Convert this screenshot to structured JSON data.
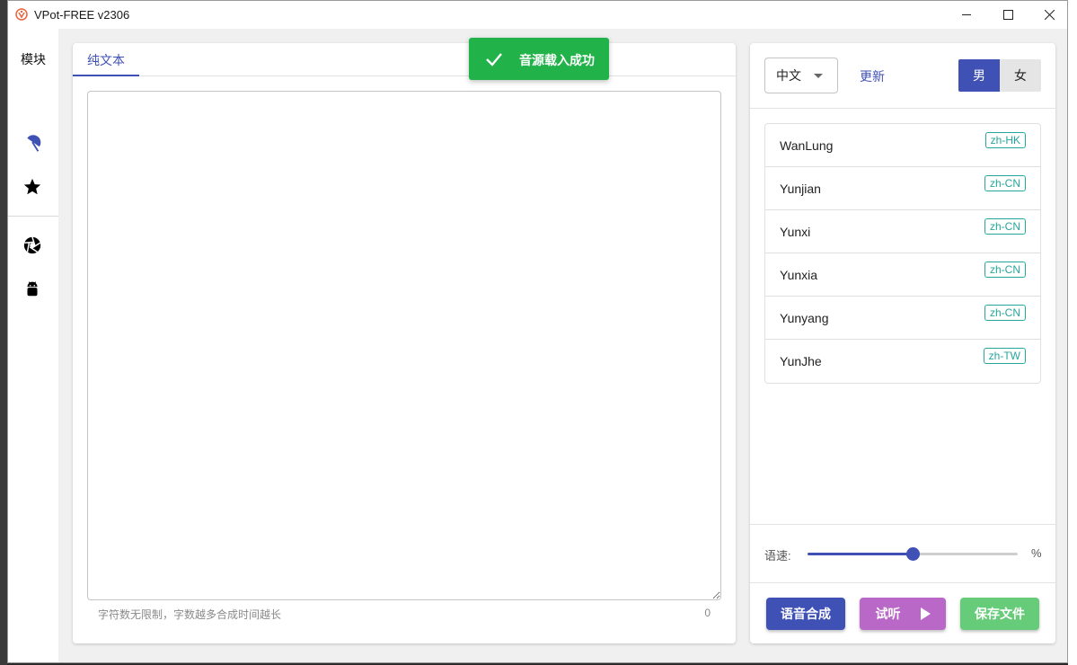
{
  "window": {
    "title": "VPot-FREE v2306",
    "brand_color": "#e8623a",
    "min_icon": "minimize-icon",
    "max_icon": "maximize-icon",
    "close_icon": "close-icon"
  },
  "sidebar": {
    "title": "模块",
    "items": [
      {
        "icon": "umbrella-icon",
        "color": "#3f51b5"
      },
      {
        "icon": "star-icon",
        "color": "#000000"
      },
      {
        "icon": "aperture-icon",
        "color": "#000000"
      },
      {
        "icon": "android-icon",
        "color": "#000000"
      }
    ]
  },
  "editor": {
    "tab_label": "纯文本",
    "text_value": "",
    "hint": "字符数无限制，字数越多合成时间越长",
    "char_count": "0"
  },
  "toast": {
    "icon": "check-icon",
    "message": "音源载入成功",
    "color": "#21b24a"
  },
  "voices": {
    "language": "中文",
    "update_label": "更新",
    "gender_male": "男",
    "gender_female": "女",
    "selected_gender": "男",
    "list": [
      {
        "name": "WanLung",
        "locale": "zh-HK"
      },
      {
        "name": "Yunjian",
        "locale": "zh-CN"
      },
      {
        "name": "Yunxi",
        "locale": "zh-CN"
      },
      {
        "name": "Yunxia",
        "locale": "zh-CN"
      },
      {
        "name": "Yunyang",
        "locale": "zh-CN"
      },
      {
        "name": "YunJhe",
        "locale": "zh-TW"
      }
    ]
  },
  "speed": {
    "label": "语速:",
    "unit": "%",
    "value_fraction": 0.5
  },
  "actions": {
    "synthesize": "语音合成",
    "preview": "试听",
    "save": "保存文件"
  },
  "colors": {
    "primary": "#3f51b5",
    "preview": "#ba68c8",
    "save": "#66cc7a",
    "badge": "#26a69a"
  }
}
